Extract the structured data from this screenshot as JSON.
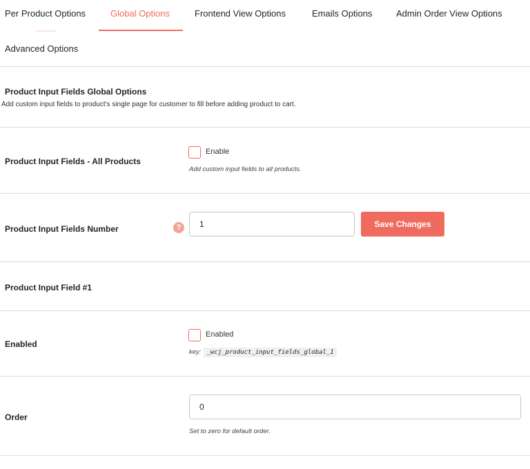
{
  "tabs": {
    "items": [
      {
        "label": "Per Product Options"
      },
      {
        "label": "Global Options"
      },
      {
        "label": "Frontend View Options"
      },
      {
        "label": "Emails Options"
      },
      {
        "label": "Admin Order View Options"
      },
      {
        "label": "Advanced Options"
      }
    ],
    "active_index": 1
  },
  "section": {
    "title": "Product Input Fields Global Options",
    "description": "Add custom input fields to product's single page for customer to fill before adding product to cart."
  },
  "rows": {
    "all_products": {
      "label": "Product Input Fields - All Products",
      "checkbox_label": "Enable",
      "checked": false,
      "help": "Add custom input fields to all products."
    },
    "fields_number": {
      "label": "Product Input Fields Number",
      "help_icon": "?",
      "value": "1",
      "save_label": "Save Changes"
    },
    "field_heading": {
      "label": "Product Input Field #1"
    },
    "enabled": {
      "label": "Enabled",
      "checkbox_label": "Enabled",
      "checked": false,
      "key_prefix": "key:",
      "key": "_wcj_product_input_fields_global_1"
    },
    "order": {
      "label": "Order",
      "value": "0",
      "help": "Set to zero for default order."
    }
  },
  "colors": {
    "accent": "#f06b5f",
    "help_icon": "#f3a396",
    "divider": "#dcdcdc"
  }
}
